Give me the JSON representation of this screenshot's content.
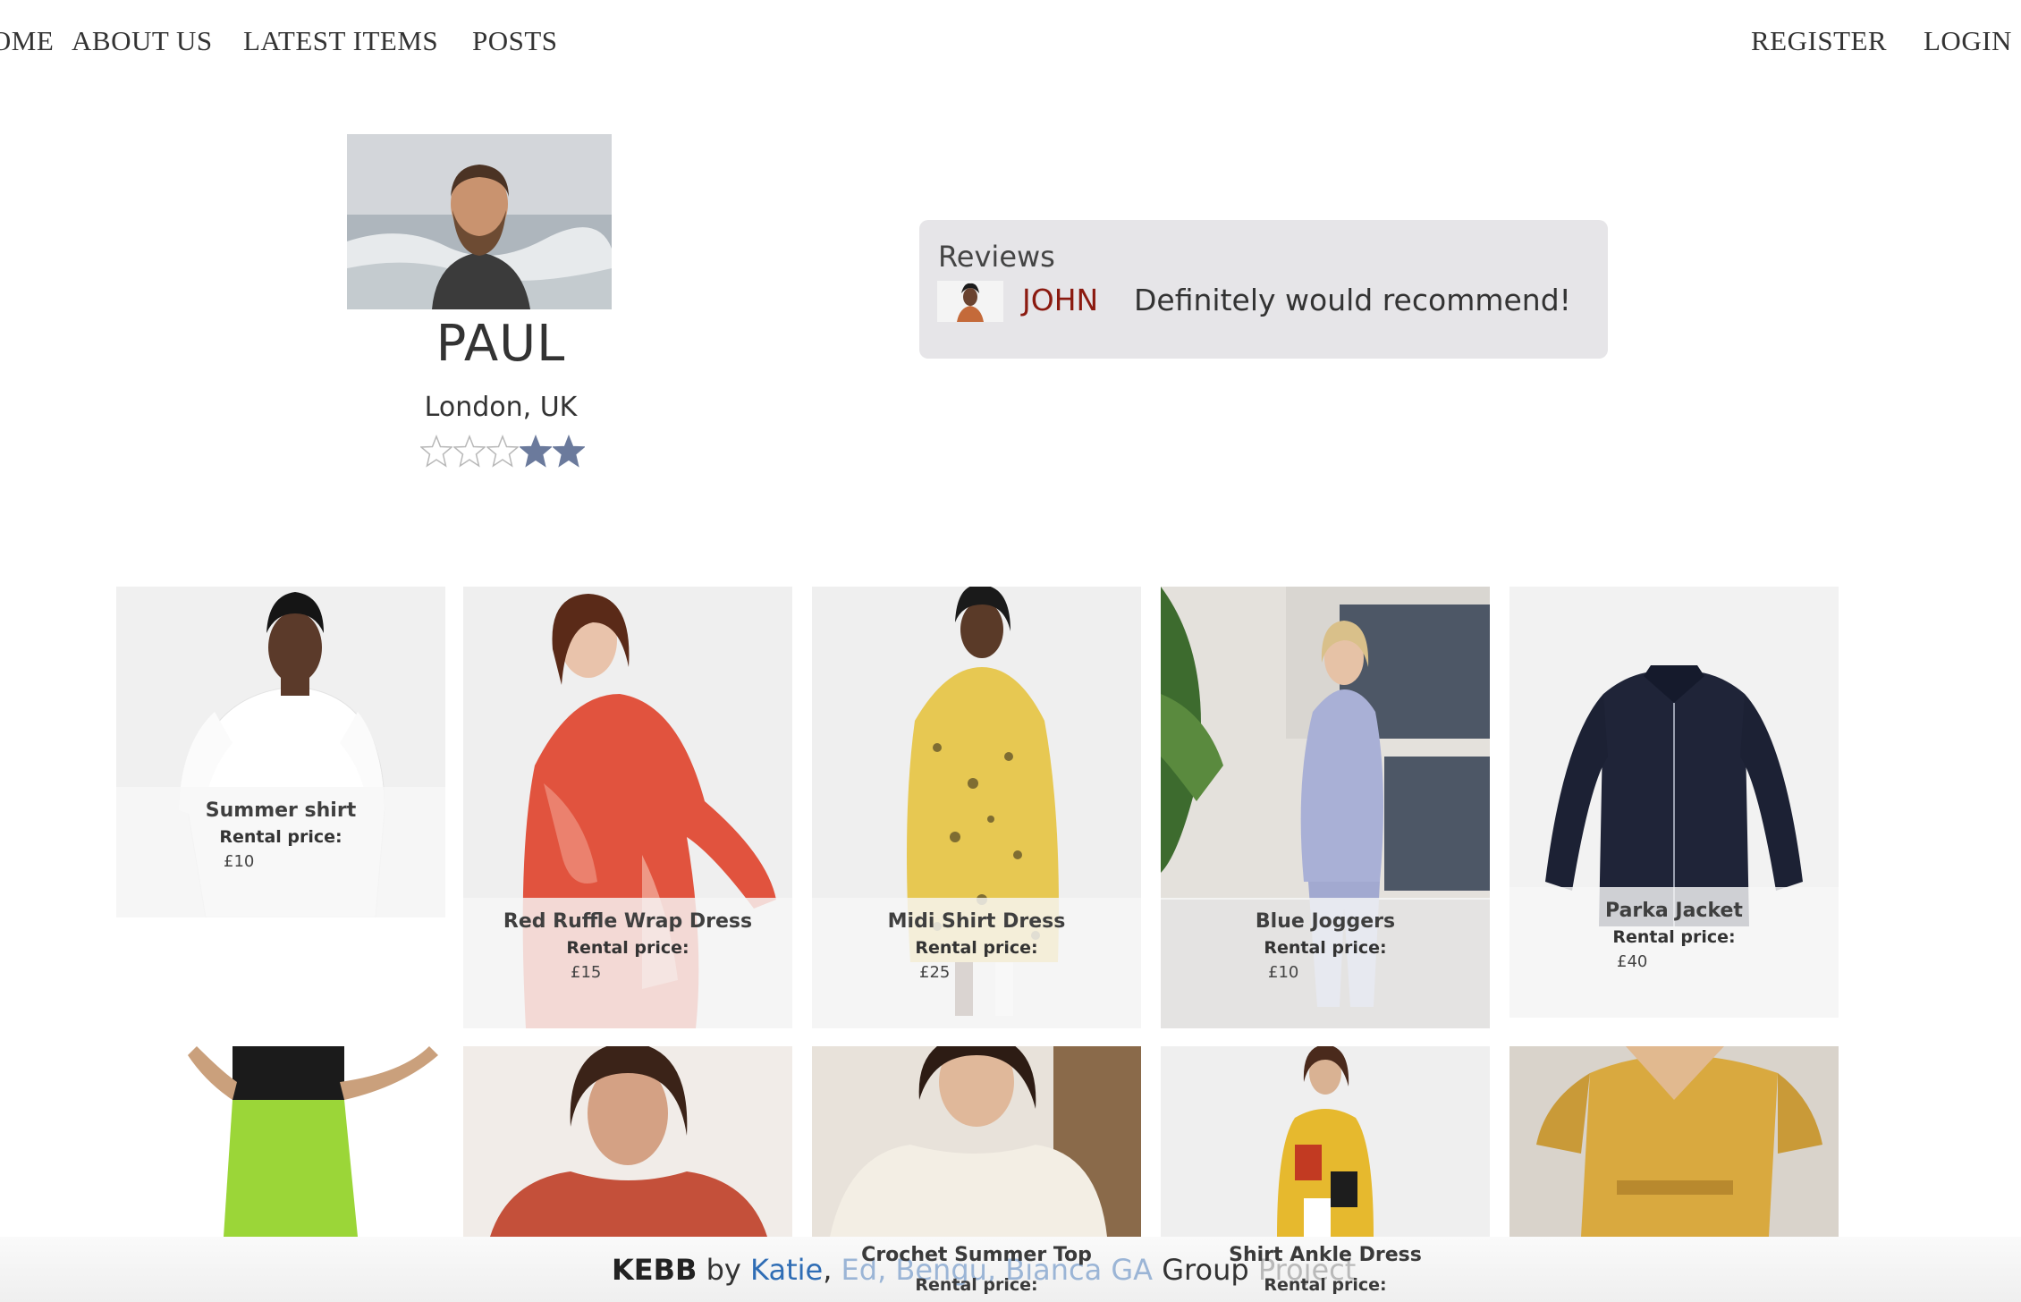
{
  "nav": {
    "home": "HOME",
    "about": "ABOUT US",
    "latest": "LATEST ITEMS",
    "posts": "POSTS",
    "register": "REGISTER",
    "login": "LOGIN"
  },
  "profile": {
    "name": "PAUL",
    "location": "London, UK",
    "rating": 2,
    "rating_max": 5,
    "star_color": "#6b7a9c"
  },
  "reviews": {
    "title": "Reviews",
    "items": [
      {
        "reviewer": "JOHN",
        "text": "Definitely would recommend!"
      }
    ]
  },
  "items": [
    {
      "title": "Summer shirt",
      "price_label": "Rental price:",
      "price": "£10"
    },
    {
      "title": "Red Ruffle Wrap Dress",
      "price_label": "Rental price:",
      "price": "£15"
    },
    {
      "title": "Midi Shirt Dress",
      "price_label": "Rental price:",
      "price": "£25"
    },
    {
      "title": "Blue Joggers",
      "price_label": "Rental price:",
      "price": "£10"
    },
    {
      "title": "Parka Jacket",
      "price_label": "Rental price:",
      "price": "£40"
    },
    {
      "title": "Crochet Summer Top",
      "price_label": "Rental price:"
    },
    {
      "title": "Shirt Ankle Dress",
      "price_label": "Rental price:"
    }
  ],
  "footer": {
    "brand": "KEBB",
    "by": "by",
    "author_1": "Katie",
    "author_2": "Ed",
    "author_3": "Bengu",
    "author_4": "Bianca",
    "ga": "GA",
    "group": "Group",
    "project": "Project"
  }
}
